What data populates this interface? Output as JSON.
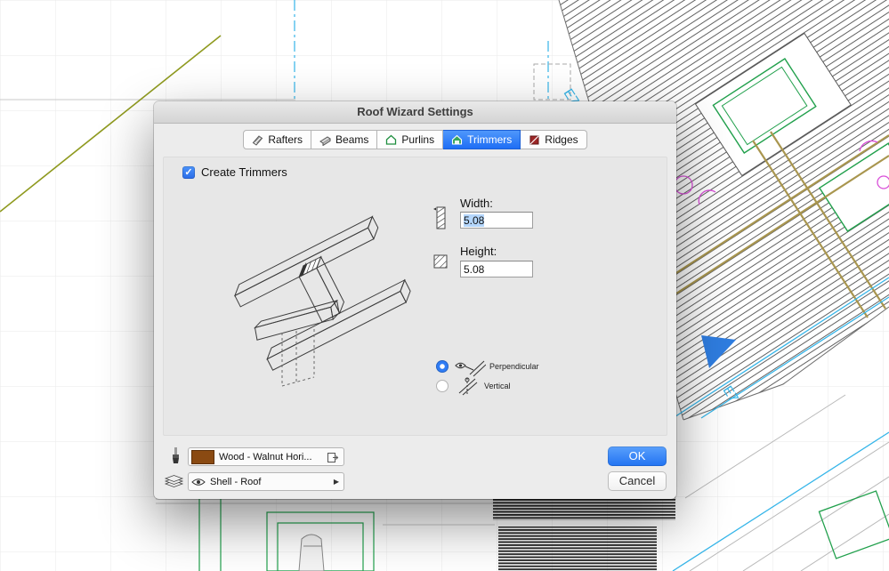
{
  "background": {
    "labels": [
      {
        "text": "E7"
      },
      {
        "text": "E7"
      }
    ],
    "colors": {
      "cyan": "#35b5e9",
      "green": "#21a04c",
      "magenta": "#d94fd9",
      "olive": "#8f9a1f",
      "triangle_blue": "#2f7de0"
    }
  },
  "dialog": {
    "title": "Roof Wizard Settings",
    "tabs": [
      {
        "label": "Rafters"
      },
      {
        "label": "Beams"
      },
      {
        "label": "Purlins"
      },
      {
        "label": "Trimmers"
      },
      {
        "label": "Ridges"
      }
    ],
    "selected_tab": "Trimmers",
    "create_trimmers": {
      "label": "Create Trimmers",
      "checked": true,
      "checkmark": "✓"
    },
    "width": {
      "label": "Width:",
      "value": "5.08"
    },
    "height": {
      "label": "Height:",
      "value": "5.08"
    },
    "orientation": [
      {
        "label": "Perpendicular",
        "selected": true
      },
      {
        "label": "Vertical",
        "selected": false
      }
    ],
    "material": {
      "value": "Wood - Walnut Hori...",
      "swatch_color": "#8a4a12"
    },
    "layer": {
      "value": "Shell - Roof",
      "arrow": "▶"
    },
    "buttons": {
      "ok": "OK",
      "cancel": "Cancel"
    },
    "accent_blue": "#2f7cf5"
  }
}
